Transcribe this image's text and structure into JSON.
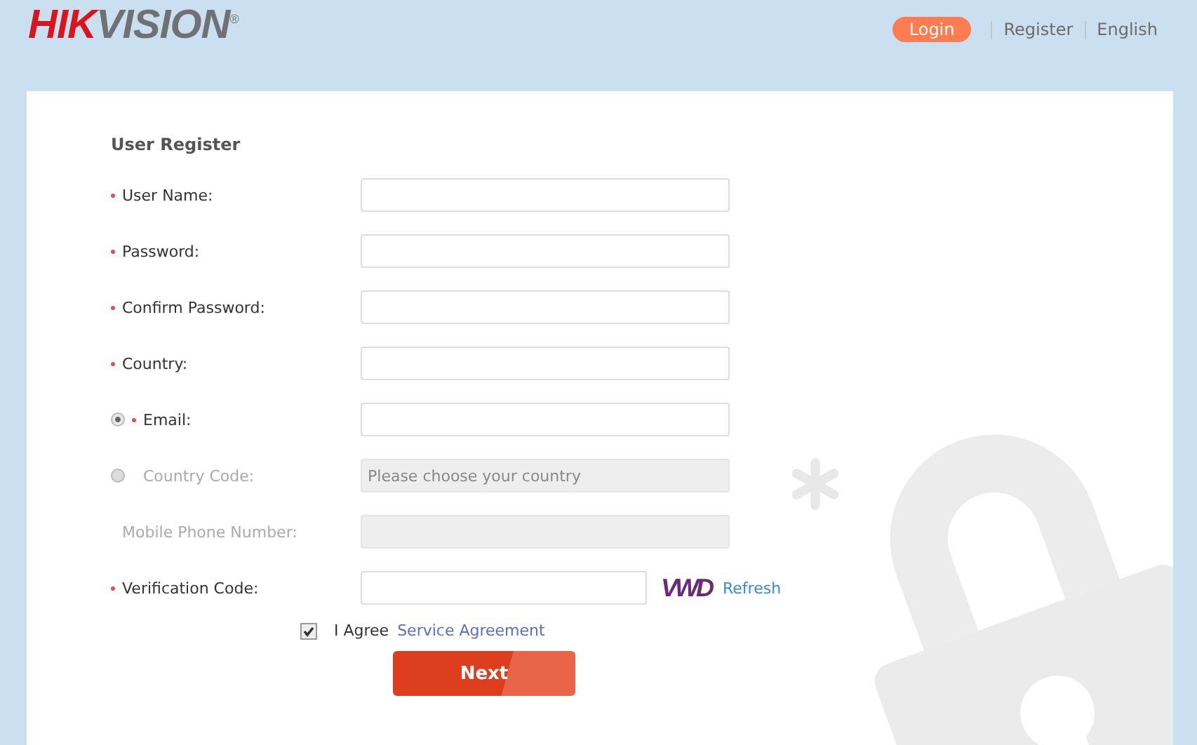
{
  "header": {
    "logo": [
      {
        "text": "HIK",
        "color": "#d8141c"
      },
      {
        "text": "VISION",
        "color": "#707174"
      }
    ],
    "logo_mark": "®",
    "nav": [
      {
        "label": "Login",
        "selected": true
      },
      {
        "label": "Register",
        "selected": false
      },
      {
        "label": "English",
        "selected": false
      }
    ]
  },
  "form": {
    "title": "User Register",
    "rows": [
      {
        "kind": "field",
        "label": "User Name:",
        "required": true,
        "disabled": false
      },
      {
        "kind": "field",
        "label": "Password:",
        "required": true,
        "disabled": false
      },
      {
        "kind": "field",
        "label": "Confirm Password:",
        "required": true,
        "disabled": false
      },
      {
        "kind": "field",
        "label": "Country:",
        "required": true,
        "disabled": false
      },
      {
        "kind": "radio",
        "label": "Email:",
        "required": true,
        "disabled": false,
        "selected": true
      },
      {
        "kind": "radio",
        "label": "Country Code:",
        "required": false,
        "disabled": true,
        "selected": false,
        "placeholder": "Please choose your country"
      },
      {
        "kind": "field",
        "label": "Mobile Phone Number:",
        "required": false,
        "disabled": true
      },
      {
        "kind": "captcha",
        "label": "Verification Code:",
        "required": true,
        "disabled": false,
        "captcha": "VWD",
        "link": "Refresh"
      }
    ],
    "agree": {
      "checked": true,
      "label": "I Agree",
      "link": "Service Agreement"
    },
    "submit": "Next"
  }
}
